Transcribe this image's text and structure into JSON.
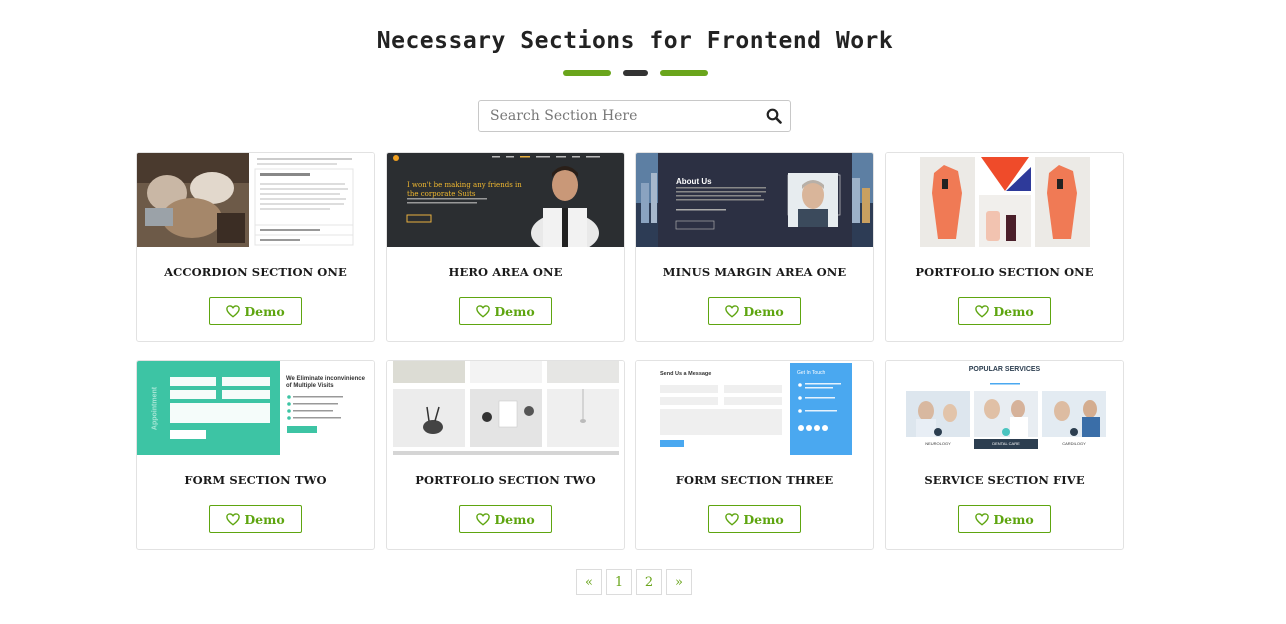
{
  "header": {
    "title": "Necessary Sections for Frontend Work",
    "underline_colors": [
      "#6aa51c",
      "#333333",
      "#6aa51c"
    ]
  },
  "search": {
    "placeholder": "Search Section Here",
    "icon": "search-icon"
  },
  "colors": {
    "accent": "#5ea510",
    "border": "#e2e2e2"
  },
  "cards": [
    {
      "title": "ACCORDION SECTION ONE",
      "button": "Demo"
    },
    {
      "title": "HERO AREA ONE",
      "button": "Demo"
    },
    {
      "title": "MINUS MARGIN AREA ONE",
      "button": "Demo"
    },
    {
      "title": "PORTFOLIO SECTION ONE",
      "button": "Demo"
    },
    {
      "title": "FORM SECTION TWO",
      "button": "Demo"
    },
    {
      "title": "PORTFOLIO SECTION TWO",
      "button": "Demo"
    },
    {
      "title": "FORM SECTION THREE",
      "button": "Demo"
    },
    {
      "title": "SERVICE SECTION FIVE",
      "button": "Demo"
    }
  ],
  "thumbnails": {
    "hero": {
      "headline": "I won't be making any friends in the corporate Suits"
    },
    "minus": {
      "heading": "About Us"
    },
    "form2": {
      "heading": "We Eliminate inconvinience of Multiple Visits",
      "side": "Appointment"
    },
    "form3": {
      "heading": "Send Us a Message",
      "side": "Get In Touch"
    },
    "service": {
      "heading": "POPULAR SERVICES",
      "labels": [
        "NEUROLOGY",
        "DENTAL CARE",
        "CARDILOGY"
      ]
    }
  },
  "pagination": {
    "prev": "«",
    "pages": [
      "1",
      "2"
    ],
    "next": "»"
  }
}
